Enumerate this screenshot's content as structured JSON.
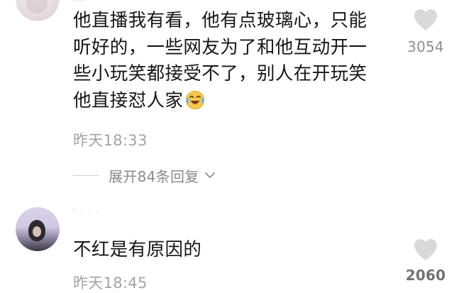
{
  "comments": [
    {
      "text_lines": [
        "他直播我有看，他有点玻璃心，只能",
        "听好的，一些网友为了和他互动开一",
        "些小玩笑都接受不了，别人在开玩笑",
        "他直接怼人家"
      ],
      "emoji": "laughing-crying-face",
      "time": "昨天18:33",
      "likes": "3054",
      "replies_label": "展开84条回复"
    },
    {
      "text_lines": [
        "不红是有原因的"
      ],
      "time": "昨天18:45",
      "likes": "2060"
    }
  ],
  "colors": {
    "text": "#161616",
    "meta": "#a3a3a3",
    "like_icon": "#d9d9d9",
    "emoji_face": "#f6c94a",
    "emoji_tear": "#6cb6f0"
  }
}
